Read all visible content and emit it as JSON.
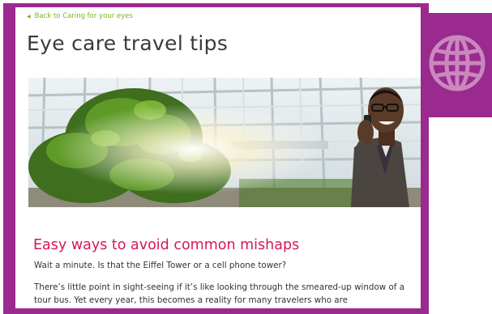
{
  "breadcrumb": {
    "back_label": "Back to Caring for your eyes"
  },
  "page": {
    "title": "Eye care travel tips"
  },
  "article": {
    "subhead": "Easy ways to avoid common mishaps",
    "intro": "Wait a minute. Is that the Eiffel Tower or a cell phone tower?",
    "body": "There’s little point in sight-seeing if it’s like looking through the smeared-up window of a tour bus. Yet every year, this becomes a reality for many travelers who are"
  },
  "icons": {
    "back": "caret-left-icon",
    "globe": "globe-icon"
  },
  "colors": {
    "brand_purple": "#9b2a8f",
    "link_green": "#7ab51d",
    "heading_pink": "#d6175a"
  }
}
